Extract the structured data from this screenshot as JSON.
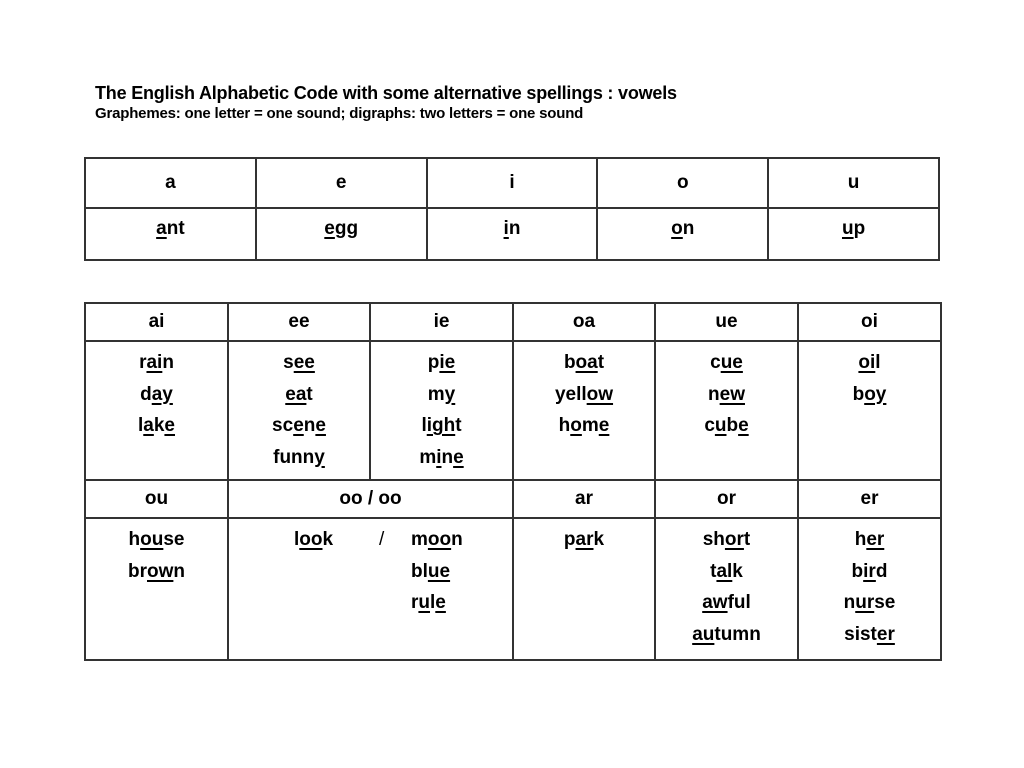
{
  "title": "The English Alphabetic Code with some alternative spellings : vowels",
  "subtitle": "Graphemes: one letter = one sound; digraphs: two letters = one sound",
  "single_vowels": [
    {
      "grapheme": "a",
      "example": [
        {
          "u": "a"
        },
        {
          "t": "nt"
        }
      ]
    },
    {
      "grapheme": "e",
      "example": [
        {
          "u": "e"
        },
        {
          "t": "gg"
        }
      ]
    },
    {
      "grapheme": "i",
      "example": [
        {
          "u": "i"
        },
        {
          "t": "n"
        }
      ]
    },
    {
      "grapheme": "o",
      "example": [
        {
          "u": "o"
        },
        {
          "t": "n"
        }
      ]
    },
    {
      "grapheme": "u",
      "example": [
        {
          "u": "u"
        },
        {
          "t": "p"
        }
      ]
    }
  ],
  "digraphs_row1": [
    {
      "grapheme": "ai",
      "words": [
        [
          {
            "t": "r"
          },
          {
            "u": "ai"
          },
          {
            "t": "n"
          }
        ],
        [
          {
            "t": "d"
          },
          {
            "u": "ay"
          }
        ],
        [
          {
            "t": "l"
          },
          {
            "u": "a"
          },
          {
            "t": "k"
          },
          {
            "u": "e"
          }
        ]
      ]
    },
    {
      "grapheme": "ee",
      "words": [
        [
          {
            "t": "s"
          },
          {
            "u": "ee"
          }
        ],
        [
          {
            "u": "ea"
          },
          {
            "t": "t"
          }
        ],
        [
          {
            "t": "sc"
          },
          {
            "u": "e"
          },
          {
            "t": "n"
          },
          {
            "u": "e"
          }
        ],
        [
          {
            "t": "funn"
          },
          {
            "u": "y"
          }
        ]
      ]
    },
    {
      "grapheme": "ie",
      "words": [
        [
          {
            "t": "p"
          },
          {
            "u": "ie"
          }
        ],
        [
          {
            "t": "m"
          },
          {
            "u": "y"
          }
        ],
        [
          {
            "t": "l"
          },
          {
            "u": "igh"
          },
          {
            "t": "t"
          }
        ],
        [
          {
            "t": "m"
          },
          {
            "u": "i"
          },
          {
            "t": "n"
          },
          {
            "u": "e"
          }
        ]
      ]
    },
    {
      "grapheme": "oa",
      "words": [
        [
          {
            "t": "b"
          },
          {
            "u": "oa"
          },
          {
            "t": "t"
          }
        ],
        [
          {
            "t": "yell"
          },
          {
            "u": "ow"
          }
        ],
        [
          {
            "t": "h"
          },
          {
            "u": "o"
          },
          {
            "t": "m"
          },
          {
            "u": "e"
          }
        ]
      ]
    },
    {
      "grapheme": "ue",
      "words": [
        [
          {
            "t": "c"
          },
          {
            "u": "ue"
          }
        ],
        [
          {
            "t": "n"
          },
          {
            "u": "ew"
          }
        ],
        [
          {
            "t": "c"
          },
          {
            "u": "u"
          },
          {
            "t": "b"
          },
          {
            "u": "e"
          }
        ]
      ]
    },
    {
      "grapheme": "oi",
      "words": [
        [
          {
            "u": "oi"
          },
          {
            "t": "l"
          }
        ],
        [
          {
            "t": "b"
          },
          {
            "u": "oy"
          }
        ]
      ]
    }
  ],
  "digraphs_row2": {
    "ou": {
      "grapheme": "ou",
      "words": [
        [
          {
            "t": "h"
          },
          {
            "u": "ou"
          },
          {
            "t": "se"
          }
        ],
        [
          {
            "t": "br"
          },
          {
            "u": "ow"
          },
          {
            "t": "n"
          }
        ]
      ]
    },
    "oo": {
      "grapheme": "oo / oo",
      "short_words": [
        [
          {
            "t": "l"
          },
          {
            "u": "oo"
          },
          {
            "t": "k"
          }
        ]
      ],
      "separator": "/",
      "long_words": [
        [
          {
            "t": "m"
          },
          {
            "u": "oo"
          },
          {
            "t": "n"
          }
        ],
        [
          {
            "t": "bl"
          },
          {
            "u": "ue"
          }
        ],
        [
          {
            "t": "r"
          },
          {
            "u": "u"
          },
          {
            "t": "l"
          },
          {
            "u": "e"
          }
        ]
      ]
    },
    "ar": {
      "grapheme": "ar",
      "words": [
        [
          {
            "t": "p"
          },
          {
            "u": "ar"
          },
          {
            "t": "k"
          }
        ]
      ]
    },
    "or": {
      "grapheme": "or",
      "words": [
        [
          {
            "t": "sh"
          },
          {
            "u": "or"
          },
          {
            "t": "t"
          }
        ],
        [
          {
            "t": "t"
          },
          {
            "u": "al"
          },
          {
            "t": "k"
          }
        ],
        [
          {
            "u": "aw"
          },
          {
            "t": "ful"
          }
        ],
        [
          {
            "u": "au"
          },
          {
            "t": "tumn"
          }
        ]
      ]
    },
    "er": {
      "grapheme": "er",
      "words": [
        [
          {
            "t": "h"
          },
          {
            "u": "er"
          }
        ],
        [
          {
            "t": "b"
          },
          {
            "u": "ir"
          },
          {
            "t": "d"
          }
        ],
        [
          {
            "t": "n"
          },
          {
            "u": "ur"
          },
          {
            "t": "se"
          }
        ],
        [
          {
            "t": "sist"
          },
          {
            "u": "er"
          }
        ]
      ]
    }
  }
}
